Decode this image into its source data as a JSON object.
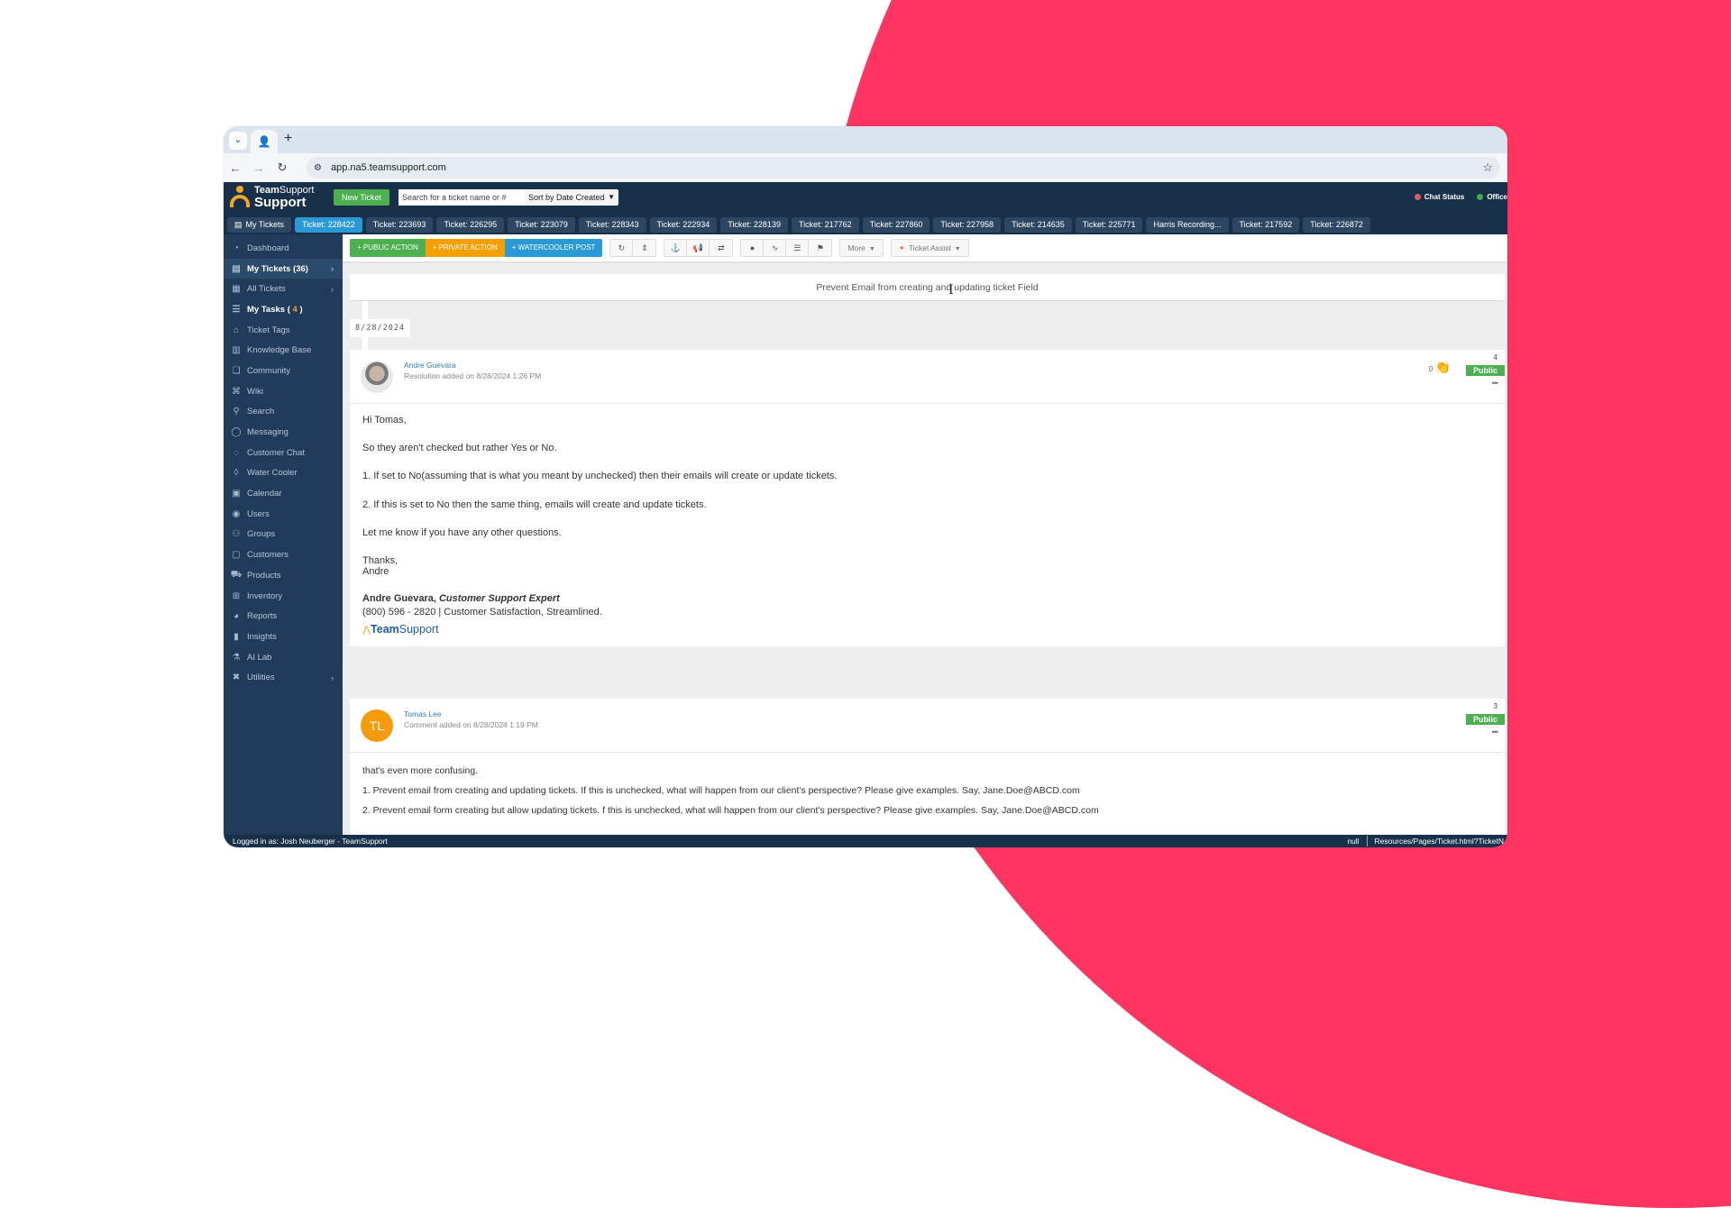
{
  "browser": {
    "url": "app.na5.teamsupport.com",
    "tab_favicon": "teamsupport-logo-icon",
    "new_tab_label": "+"
  },
  "header": {
    "logo_top_bold": "Team",
    "logo_top_rest": "Support",
    "logo_bottom": "Support",
    "new_ticket_label": "New Ticket",
    "search_placeholder": "Search for a ticket name or #",
    "sort_label": "Sort by Date Created",
    "status": [
      {
        "label": "Chat Status",
        "color": "#e05a63"
      },
      {
        "label": "Office",
        "color": "#3fae49"
      }
    ]
  },
  "ticket_tabs": {
    "my_tickets_label": "My Tickets",
    "tabs": [
      {
        "label": "Ticket: 228422",
        "active": true
      },
      {
        "label": "Ticket: 223693"
      },
      {
        "label": "Ticket: 226295"
      },
      {
        "label": "Ticket: 223079"
      },
      {
        "label": "Ticket: 228343"
      },
      {
        "label": "Ticket: 222934"
      },
      {
        "label": "Ticket: 228139"
      },
      {
        "label": "Ticket: 217762"
      },
      {
        "label": "Ticket: 227860"
      },
      {
        "label": "Ticket: 227958"
      },
      {
        "label": "Ticket: 214635"
      },
      {
        "label": "Ticket: 225771"
      },
      {
        "label": "Harris Recording..."
      },
      {
        "label": "Ticket: 217592"
      },
      {
        "label": "Ticket: 226872"
      }
    ]
  },
  "sidebar": {
    "items": [
      {
        "label": "Dashboard",
        "icon": "dashboard-icon"
      },
      {
        "label": "My Tickets (36)",
        "icon": "ticket-icon",
        "bold": true,
        "active": true,
        "chevron": true
      },
      {
        "label": "All Tickets",
        "icon": "tickets-icon",
        "chevron": true
      },
      {
        "label": "My Tasks (",
        "count": "4",
        "suffix": ")",
        "icon": "tasks-icon",
        "bold": true
      },
      {
        "label": "Ticket Tags",
        "icon": "tag-icon"
      },
      {
        "label": "Knowledge Base",
        "icon": "books-icon"
      },
      {
        "label": "Community",
        "icon": "chat-bubbles-icon"
      },
      {
        "label": "Wiki",
        "icon": "puzzle-icon"
      },
      {
        "label": "Search",
        "icon": "search-icon"
      },
      {
        "label": "Messaging",
        "icon": "messaging-icon"
      },
      {
        "label": "Customer Chat",
        "icon": "chat-icon"
      },
      {
        "label": "Water Cooler",
        "icon": "drop-icon"
      },
      {
        "label": "Calendar",
        "icon": "calendar-icon"
      },
      {
        "label": "Users",
        "icon": "user-circle-icon"
      },
      {
        "label": "Groups",
        "icon": "group-icon"
      },
      {
        "label": "Customers",
        "icon": "contact-card-icon"
      },
      {
        "label": "Products",
        "icon": "cart-icon"
      },
      {
        "label": "Inventory",
        "icon": "boxes-icon"
      },
      {
        "label": "Reports",
        "icon": "pie-chart-icon"
      },
      {
        "label": "Insights",
        "icon": "bar-chart-icon"
      },
      {
        "label": "AI Lab",
        "icon": "flask-icon"
      },
      {
        "label": "Utilities",
        "icon": "tools-icon",
        "chevron": true
      }
    ]
  },
  "toolbar": {
    "public_action": "+ PUBLIC ACTION",
    "private_action": "+ PRIVATE ACTION",
    "watercooler_post": "+ WATERCOOLER POST",
    "more_label": "More",
    "ticket_assist_label": "Ticket Assist"
  },
  "ticket": {
    "title": "Prevent Email from creating and updating ticket Field",
    "date": "8/28/2024"
  },
  "entries": [
    {
      "number": "4",
      "author": "Andre Guevara",
      "meta": "Resolution added on 8/28/2024 1:26 PM",
      "visibility": "Public",
      "reactions": "0",
      "body": [
        "Hi Tomas,",
        "So they aren't checked but rather Yes or No.",
        "1. If  set to No(assuming that is what you meant by unchecked) then their emails will create or update tickets.",
        "2. If this is set to No then the same thing, emails will create and update tickets.",
        "Let me know if you have any other questions."
      ],
      "closing": "Thanks,",
      "closing_name": "Andre",
      "signature_name": "Andre Guevara, ",
      "signature_title": "Customer Support Expert",
      "signature_line": "(800) 596 - 2820 | Customer Satisfaction, Streamlined.",
      "signature_logo_bold": "Team",
      "signature_logo_rest": "Support"
    },
    {
      "number": "3",
      "author": "Tomas Lee",
      "initials": "TL",
      "meta": "Comment added on 8/28/2024 1:19 PM",
      "visibility": "Public",
      "body": [
        "that's even more confusing.",
        "1. Prevent email from creating and updating tickets. If this is unchecked, what will happen from our client's perspective? Please give examples. Say, Jane.Doe@ABCD.com",
        "2. Prevent email form creating but allow updating tickets.  f this is unchecked, what will happen from our client's perspective? Please give examples.   Say, Jane.Doe@ABCD.com"
      ]
    }
  ],
  "statusbar": {
    "logged_in": "Logged in as: Josh Neuberger - TeamSupport",
    "null_label": "null",
    "path": "Resources/Pages/Ticket.html?TicketN"
  },
  "colors": {
    "background_accent": "#ff3460",
    "header": "#19304a",
    "sidebar": "#213c5b",
    "active_tab": "#2a9ad6",
    "public_green": "#4caf50",
    "private_orange": "#f5a000"
  }
}
